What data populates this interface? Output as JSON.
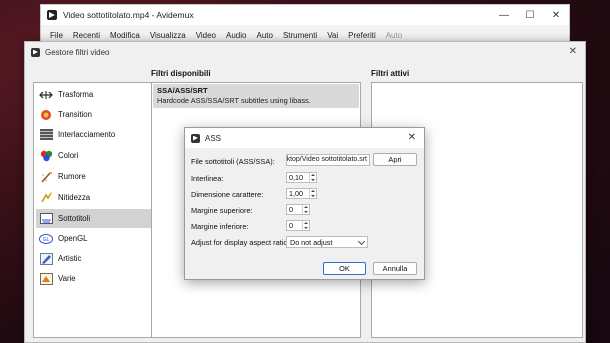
{
  "main_window": {
    "title": "Video sottotitolato.mp4 - Avidemux",
    "menu": [
      {
        "label": "File",
        "enabled": true
      },
      {
        "label": "Recenti",
        "enabled": true
      },
      {
        "label": "Modifica",
        "enabled": true
      },
      {
        "label": "Visualizza",
        "enabled": true
      },
      {
        "label": "Video",
        "enabled": true
      },
      {
        "label": "Audio",
        "enabled": true
      },
      {
        "label": "Auto",
        "enabled": true
      },
      {
        "label": "Strumenti",
        "enabled": true
      },
      {
        "label": "Vai",
        "enabled": true
      },
      {
        "label": "Preferiti",
        "enabled": true
      },
      {
        "label": "Auto",
        "enabled": false
      }
    ]
  },
  "filter_window": {
    "title": "Gestore filtri video",
    "available_heading": "Filtri disponibili",
    "active_heading": "Filtri attivi",
    "categories": [
      {
        "label": "Trasforma",
        "icon": "transform-icon"
      },
      {
        "label": "Transition",
        "icon": "transition-icon"
      },
      {
        "label": "Interlacciamento",
        "icon": "interlace-icon"
      },
      {
        "label": "Colori",
        "icon": "colors-icon"
      },
      {
        "label": "Rumore",
        "icon": "noise-icon"
      },
      {
        "label": "Nitidezza",
        "icon": "sharpness-icon"
      },
      {
        "label": "Sottotitoli",
        "icon": "subtitles-icon",
        "selected": true
      },
      {
        "label": "OpenGL",
        "icon": "opengl-icon"
      },
      {
        "label": "Artistic",
        "icon": "artistic-icon"
      },
      {
        "label": "Varie",
        "icon": "misc-icon"
      }
    ],
    "available_filter": {
      "name": "SSA/ASS/SRT",
      "description": "Hardcode ASS/SSA/SRT subtitles using libass."
    }
  },
  "ass_dialog": {
    "title": "ASS",
    "file_label": "File sottotitoli (ASS/SSA):",
    "file_value": "ktop/Video sottotitolato.srt",
    "open_button": "Apri",
    "line_spacing_label": "Interlinea:",
    "line_spacing_value": "0,10",
    "font_size_label": "Dimensione carattere:",
    "font_size_value": "1,00",
    "top_margin_label": "Margine superiore:",
    "top_margin_value": "0",
    "bottom_margin_label": "Margine inferiore:",
    "bottom_margin_value": "0",
    "aspect_label": "Adjust for display aspect ratio:",
    "aspect_value": "Do not adjust",
    "ok_button": "OK",
    "cancel_button": "Annulla"
  },
  "colors": {
    "accent": "#2b6fd1",
    "selection": "#d2d2d2",
    "desktop": "#3a1018"
  }
}
